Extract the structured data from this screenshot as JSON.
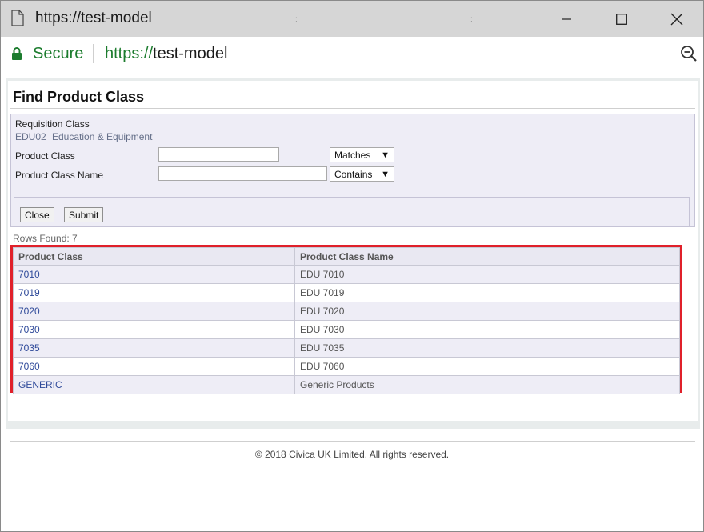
{
  "window": {
    "title": "https://test-model"
  },
  "address": {
    "secure_label": "Secure",
    "url_protocol": "https://",
    "url_host": "test-model"
  },
  "page": {
    "title": "Find Product Class",
    "requisition_label": "Requisition Class",
    "requisition_code": "EDU02",
    "requisition_name": "Education & Equipment",
    "product_class_label": "Product Class",
    "product_class_value": "",
    "product_class_operator": "Matches",
    "product_class_name_label": "Product Class Name",
    "product_class_name_value": "",
    "product_class_name_operator": "Contains",
    "close_label": "Close",
    "submit_label": "Submit",
    "rows_found": "Rows Found: 7"
  },
  "results": {
    "headers": [
      "Product Class",
      "Product Class Name"
    ],
    "rows": [
      [
        "7010",
        "EDU 7010"
      ],
      [
        "7019",
        "EDU 7019"
      ],
      [
        "7020",
        "EDU 7020"
      ],
      [
        "7030",
        "EDU 7030"
      ],
      [
        "7035",
        "EDU 7035"
      ],
      [
        "7060",
        "EDU 7060"
      ],
      [
        "GENERIC",
        "Generic Products"
      ]
    ]
  },
  "footer": {
    "copyright": "© 2018 Civica UK Limited. All rights reserved."
  },
  "colors": {
    "secure_green": "#1c7c2e",
    "highlight_red": "#e0202a",
    "link_blue": "#2f4a9a"
  }
}
